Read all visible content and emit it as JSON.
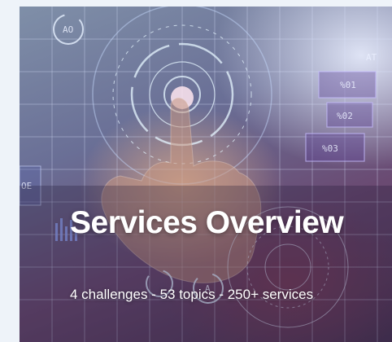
{
  "hero": {
    "title": "Services Overview",
    "subtitle": "4 challenges - 53 topics - 250+ services",
    "image": {
      "label_ao": "AO",
      "label_10": "%01",
      "label_20": "%02",
      "label_30": "%03",
      "label_at": "AT",
      "label_a": "A",
      "label_left": "OE"
    }
  }
}
